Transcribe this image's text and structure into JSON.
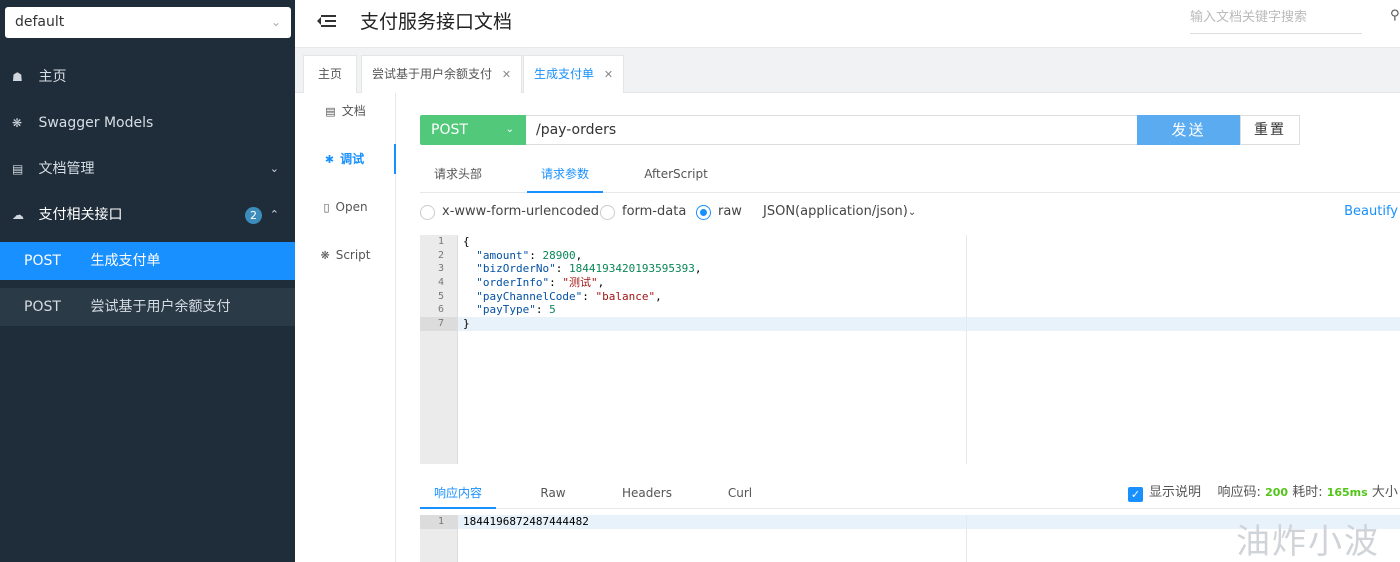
{
  "sidebar": {
    "group_value": "default",
    "items": [
      {
        "icon": "home-icon",
        "label": "主页"
      },
      {
        "icon": "swagger-models-icon",
        "label": "Swagger Models"
      },
      {
        "icon": "docs-manage-icon",
        "label": "文档管理"
      },
      {
        "icon": "cloud-icon",
        "label": "支付相关接口",
        "badge": "2"
      }
    ],
    "sub_items": [
      {
        "method": "POST",
        "label": "生成支付单",
        "active": true
      },
      {
        "method": "POST",
        "label": "尝试基于用户余额支付",
        "active": false
      }
    ]
  },
  "header": {
    "title": "支付服务接口文档",
    "search_placeholder": "输入文档关键字搜索"
  },
  "tabs": [
    {
      "label": "主页"
    },
    {
      "label": "尝试基于用户余额支付"
    },
    {
      "label": "生成支付单",
      "active": true
    }
  ],
  "vnav": [
    {
      "label": "文档"
    },
    {
      "label": "调试",
      "active": true
    },
    {
      "label": "Open"
    },
    {
      "label": "Script"
    }
  ],
  "request": {
    "method": "POST",
    "url": "/pay-orders",
    "send_label": "发送",
    "reset_label": "重置"
  },
  "param_tabs": [
    {
      "label": "请求头部"
    },
    {
      "label": "请求参数",
      "active": true
    },
    {
      "label": "AfterScript"
    }
  ],
  "body_types": [
    {
      "label": "x-www-form-urlencoded",
      "checked": false
    },
    {
      "label": "form-data",
      "checked": false
    },
    {
      "label": "raw",
      "checked": true
    }
  ],
  "content_type": "JSON(application/json)",
  "beautify_label": "Beautify",
  "request_body": {
    "line_numbers": [
      "1",
      "2",
      "3",
      "4",
      "5",
      "6",
      "7"
    ],
    "open_brace": "{",
    "close_brace": "}",
    "fields": [
      {
        "key": "\"amount\"",
        "value": "28900",
        "type": "n",
        "comma": ","
      },
      {
        "key": "\"bizOrderNo\"",
        "value": "1844193420193595393",
        "type": "n",
        "comma": ","
      },
      {
        "key": "\"orderInfo\"",
        "value": "\"测试\"",
        "type": "s",
        "comma": ","
      },
      {
        "key": "\"payChannelCode\"",
        "value": "\"balance\"",
        "type": "s",
        "comma": ","
      },
      {
        "key": "\"payType\"",
        "value": "5",
        "type": "n",
        "comma": ""
      }
    ]
  },
  "response_tabs": [
    {
      "label": "响应内容",
      "active": true
    },
    {
      "label": "Raw"
    },
    {
      "label": "Headers"
    },
    {
      "label": "Curl"
    }
  ],
  "response_meta": {
    "show_desc_label": "显示说明",
    "code_label": "响应码:",
    "code_value": "200",
    "time_label": "耗时:",
    "time_value": "165ms",
    "size_label": "大小"
  },
  "response_body": {
    "line_number": "1",
    "content": "1844196872487444482"
  },
  "watermark": "油炸小波",
  "colors": {
    "sidebar_bg": "#1f2d3a",
    "active_blue": "#1890ff",
    "post_green": "#52c97a",
    "send_blue": "#5aabf0"
  }
}
